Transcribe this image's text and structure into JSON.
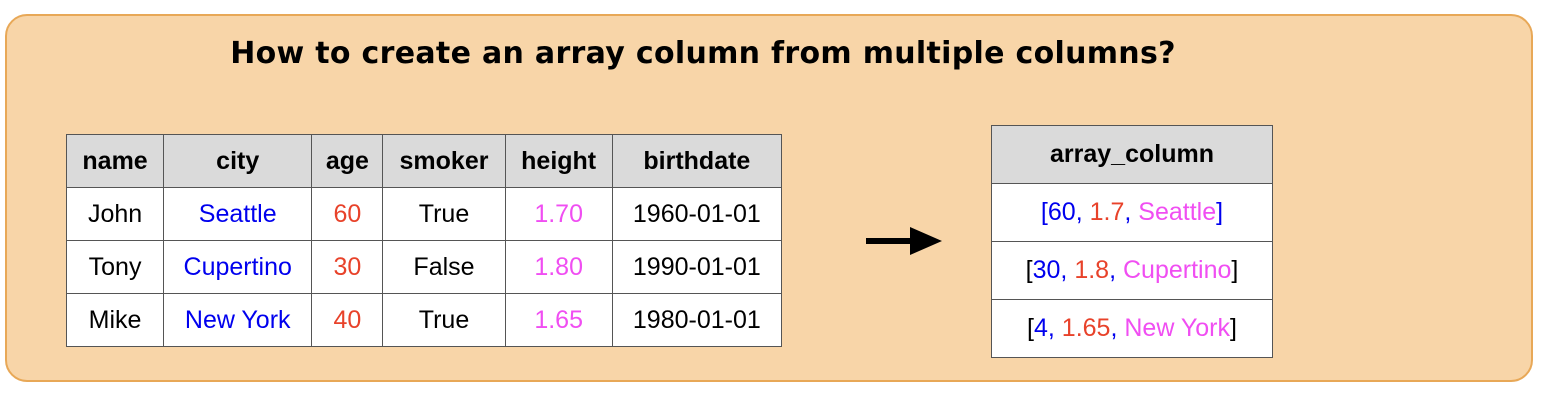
{
  "title": "How to create an array column from multiple columns?",
  "colors": {
    "panel_bg": "#f8d5a8",
    "panel_border": "#e8a857",
    "header_bg": "#dadada",
    "blue": "#0000ee",
    "red": "#e8422a",
    "magenta": "#f04ef2"
  },
  "source_table": {
    "headers": [
      "name",
      "city",
      "age",
      "smoker",
      "height",
      "birthdate"
    ],
    "rows": [
      [
        "John",
        "Seattle",
        "60",
        "True",
        "1.70",
        "1960-01-01"
      ],
      [
        "Tony",
        "Cupertino",
        "30",
        "False",
        "1.80",
        "1990-01-01"
      ],
      [
        "Mike",
        "New York",
        "40",
        "True",
        "1.65",
        "1980-01-01"
      ]
    ]
  },
  "arrow_icon": "right-arrow-icon",
  "result_table": {
    "header": "array_column",
    "rows": [
      {
        "open": "[",
        "age": "60",
        "sep1": ", ",
        "height": "1.7",
        "sep2": ", ",
        "city": "Seattle",
        "close": "]"
      },
      {
        "open": "[",
        "age": "30",
        "sep1": ", ",
        "height": "1.8",
        "sep2": ", ",
        "city": "Cupertino",
        "close": "]"
      },
      {
        "open": "[",
        "age": "4",
        "sep1": ", ",
        "height": "1.65",
        "sep2": ", ",
        "city": "New York",
        "close": "]"
      }
    ]
  }
}
